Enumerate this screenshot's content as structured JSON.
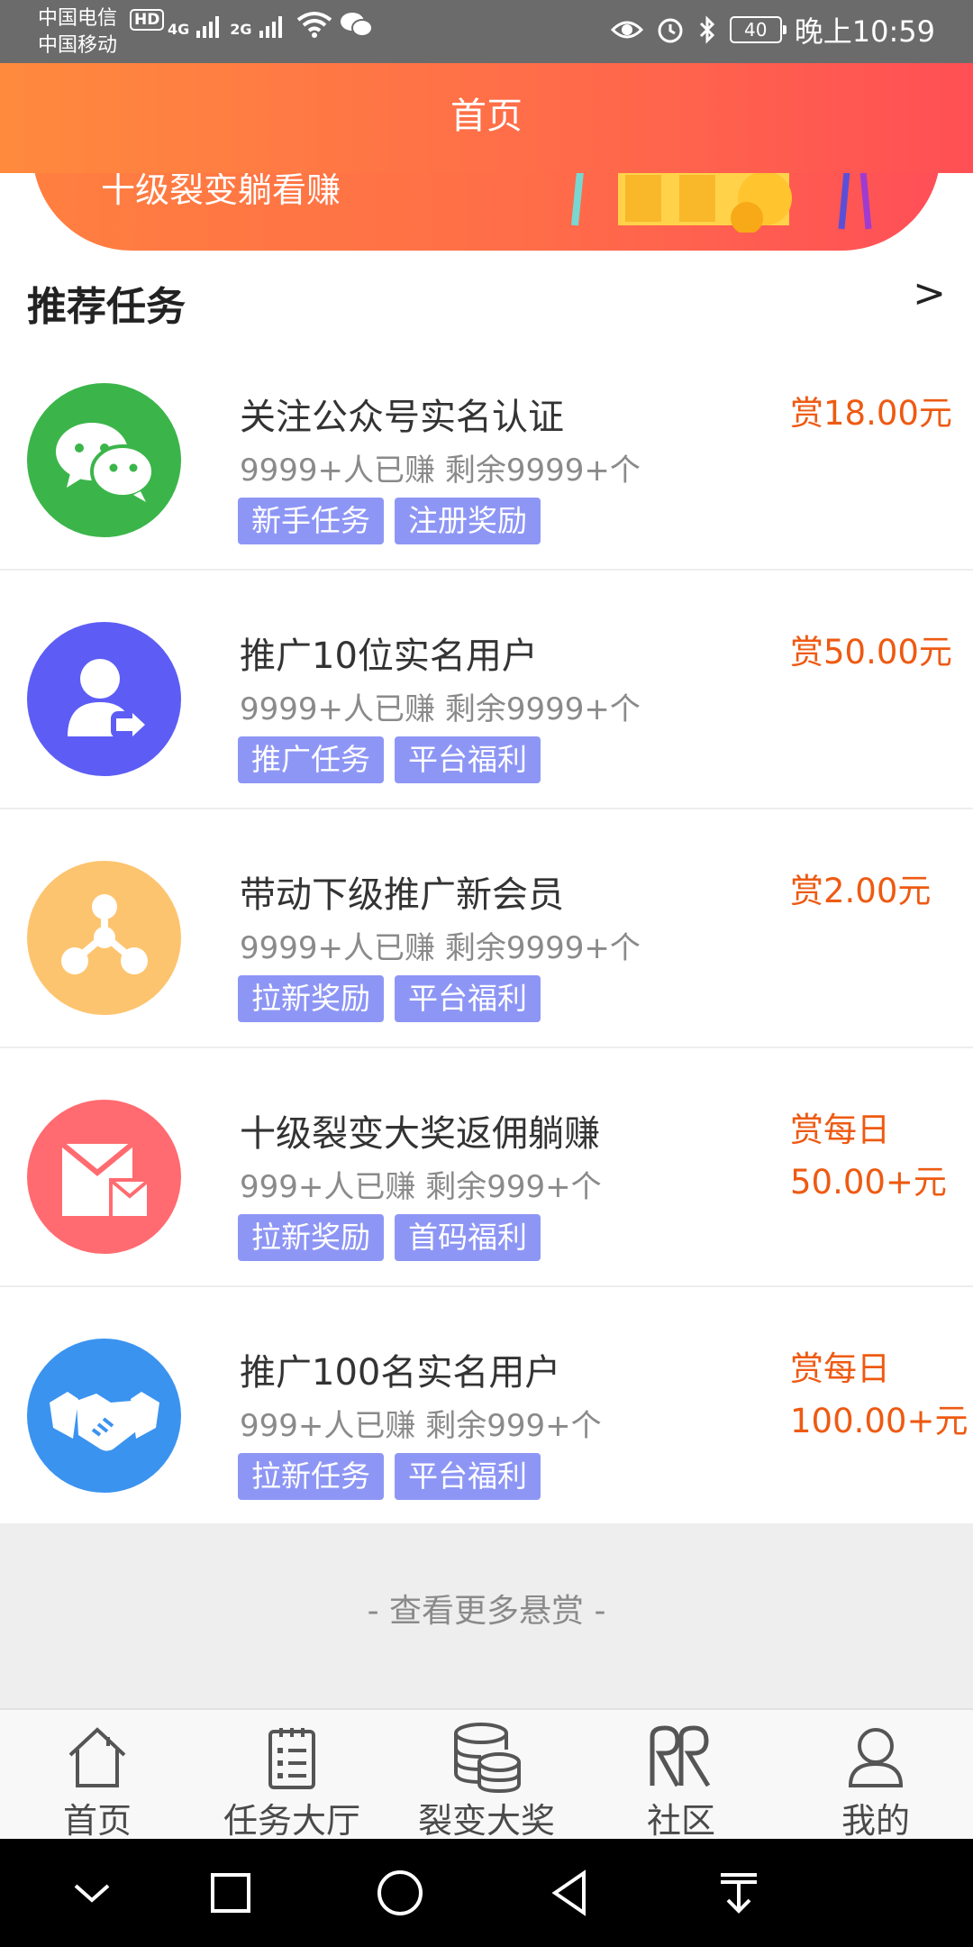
{
  "status_bar": {
    "carrier_1": "中国电信",
    "carrier_2": "中国移动",
    "hd_badge": "HD",
    "net_1": "4G",
    "net_2": "2G",
    "battery": "40",
    "time": "晚上10:59"
  },
  "header": {
    "title": "首页"
  },
  "banner": {
    "text": "十级裂变躺看赚"
  },
  "section": {
    "title": "推荐任务",
    "more": ">"
  },
  "tasks": [
    {
      "icon": "wechat-icon",
      "icon_color": "#3bb54a",
      "title": "关注公众号实名认证",
      "stats": "9999+人已赚 剩余9999+个",
      "tags": [
        "新手任务",
        "注册奖励"
      ],
      "reward_line1": "赏18.00元",
      "reward_line2": ""
    },
    {
      "icon": "user-share-icon",
      "icon_color": "#5d5df5",
      "title": "推广10位实名用户",
      "stats": "9999+人已赚 剩余9999+个",
      "tags": [
        "推广任务",
        "平台福利"
      ],
      "reward_line1": "赏50.00元",
      "reward_line2": ""
    },
    {
      "icon": "network-icon",
      "icon_color": "#fdc46f",
      "title": "带动下级推广新会员",
      "stats": "9999+人已赚 剩余9999+个",
      "tags": [
        "拉新奖励",
        "平台福利"
      ],
      "reward_line1": "赏2.00元",
      "reward_line2": ""
    },
    {
      "icon": "envelope-icon",
      "icon_color": "#ff6b70",
      "title": "十级裂变大奖返佣躺赚",
      "stats": "999+人已赚 剩余999+个",
      "tags": [
        "拉新奖励",
        "首码福利"
      ],
      "reward_line1": "赏每日",
      "reward_line2": "50.00+元"
    },
    {
      "icon": "handshake-icon",
      "icon_color": "#3b93f0",
      "title": "推广100名实名用户",
      "stats": "999+人已赚 剩余999+个",
      "tags": [
        "拉新任务",
        "平台福利"
      ],
      "reward_line1": "赏每日",
      "reward_line2": "100.00+元"
    }
  ],
  "more": {
    "text": "- 查看更多悬赏 -"
  },
  "bottom_nav": [
    {
      "icon": "home-icon",
      "label": "首页"
    },
    {
      "icon": "checklist-icon",
      "label": "任务大厅"
    },
    {
      "icon": "coins-stack-icon",
      "label": "裂变大奖"
    },
    {
      "icon": "community-icon",
      "label": "社区"
    },
    {
      "icon": "profile-icon",
      "label": "我的"
    }
  ],
  "colors": {
    "header_start": "#ff8a3d",
    "header_end": "#ff4f55",
    "tag_bg": "#8e96f5",
    "reward": "#ee5a12"
  }
}
